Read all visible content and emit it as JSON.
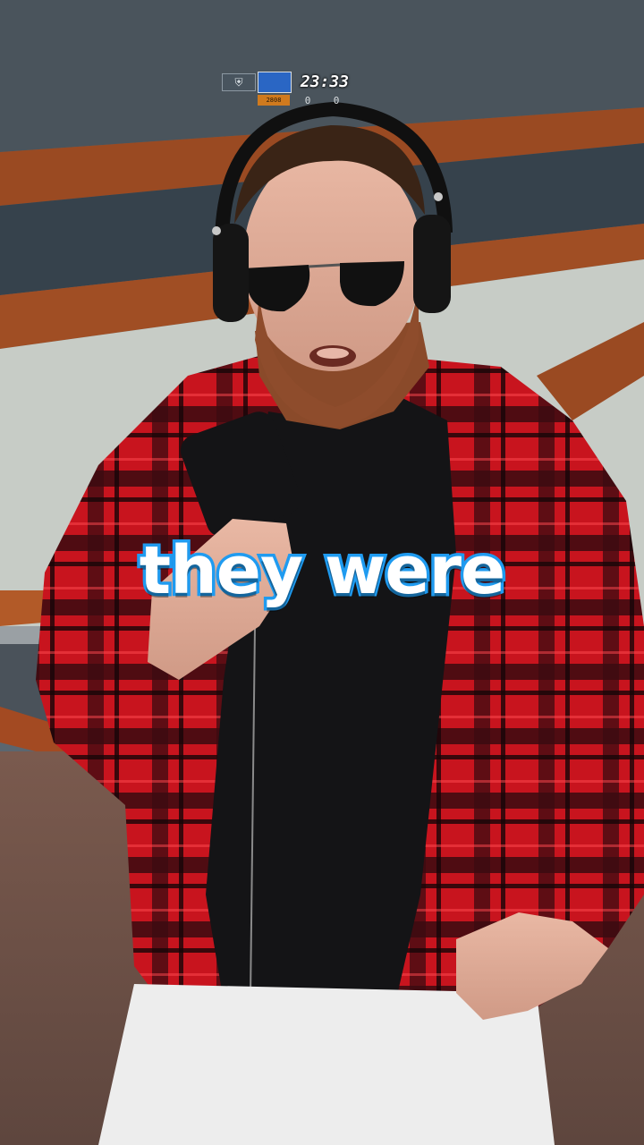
{
  "hud": {
    "team_left_icon": "ct-team-icon",
    "team_right_icon": "t-team-icon",
    "team_right_sublabel": "2808",
    "timer": "23:33",
    "score_left": "0",
    "score_right": "0"
  },
  "caption": {
    "text": "they were"
  },
  "colors": {
    "caption_fill": "#ffffff",
    "caption_outline": "#1f9bf0",
    "wall_stripe": "#9a4a22",
    "shirt_red": "#c8141e"
  }
}
